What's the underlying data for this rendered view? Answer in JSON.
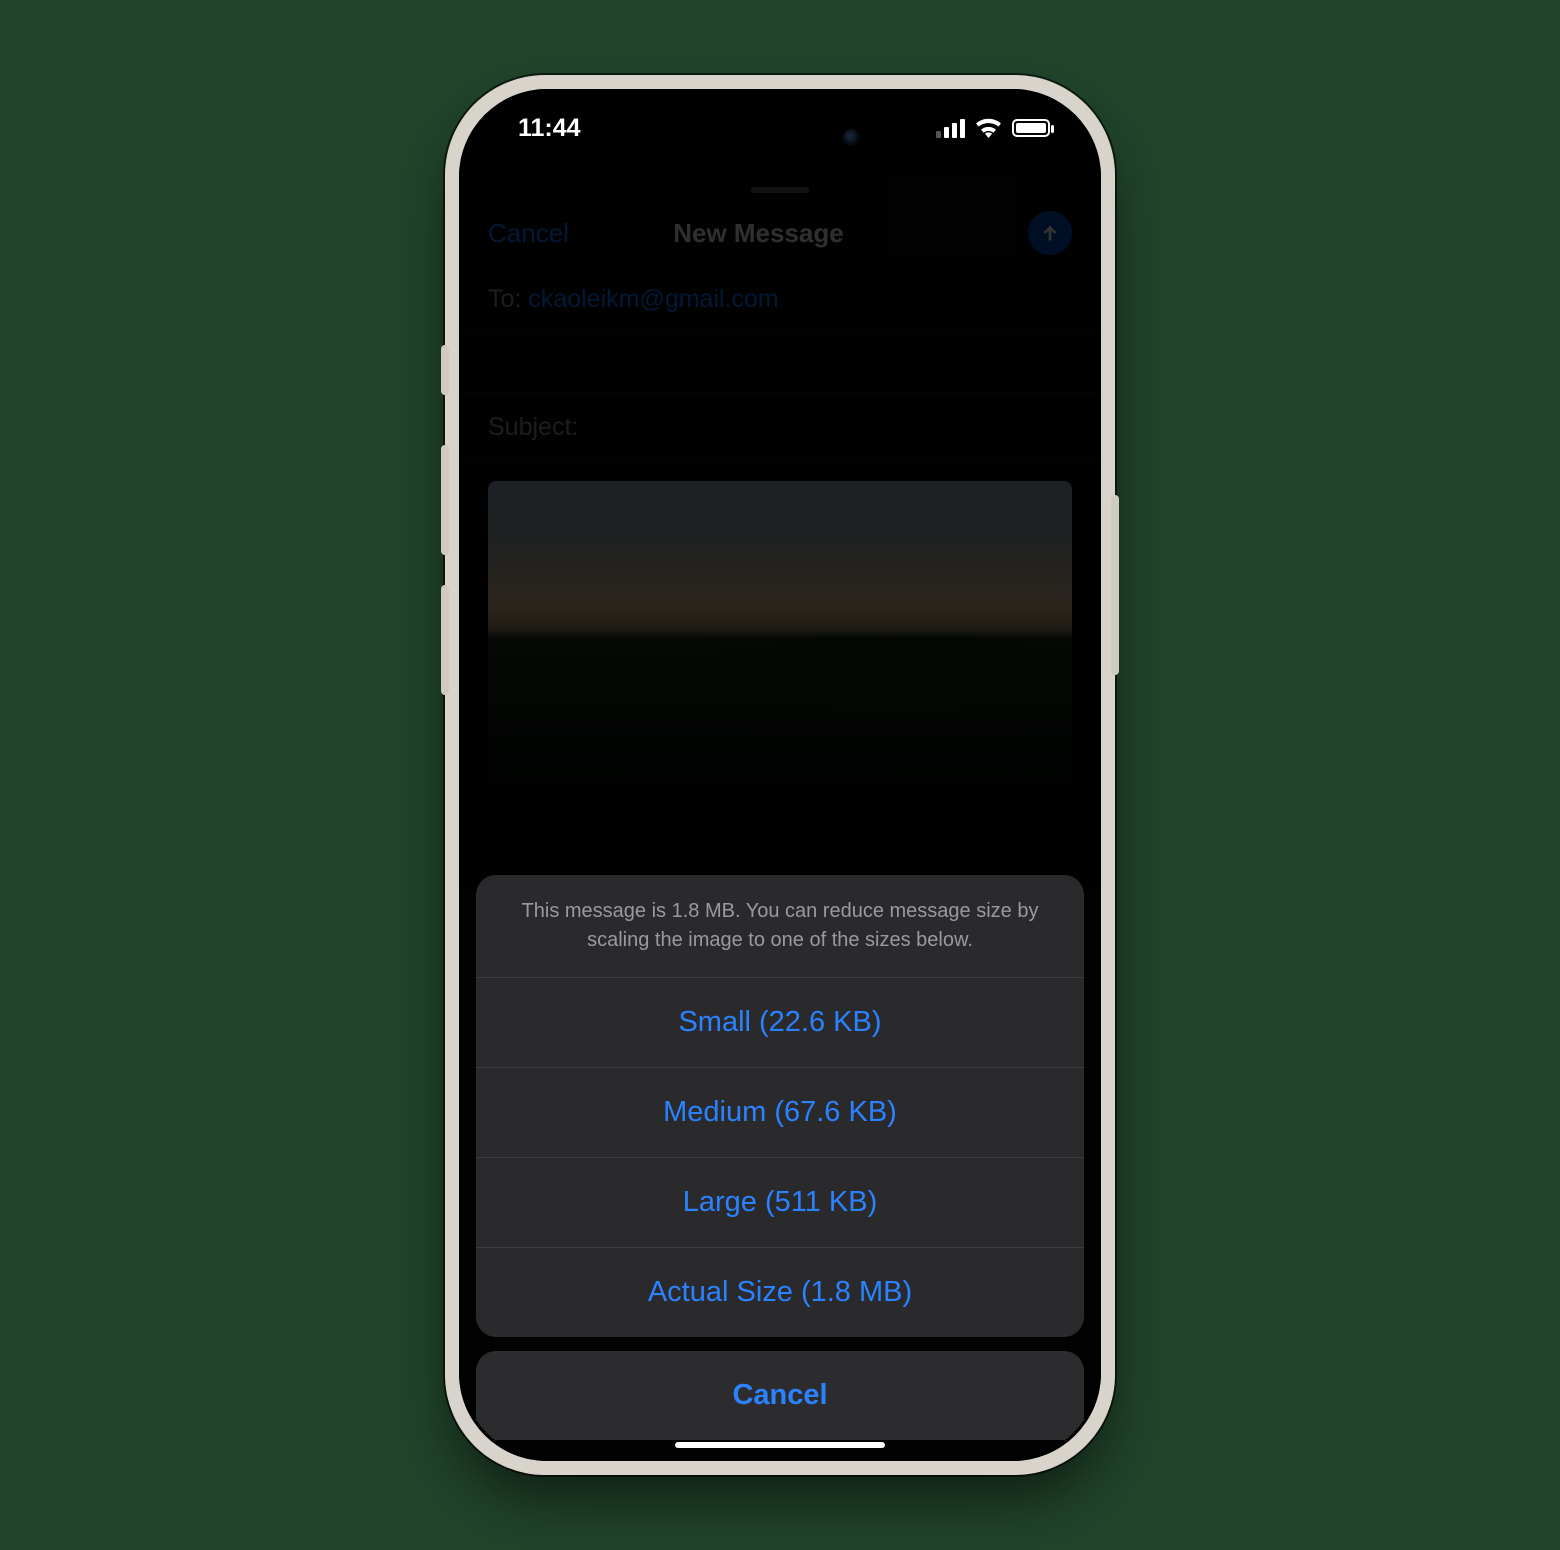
{
  "status": {
    "time": "11:44"
  },
  "compose": {
    "cancel": "Cancel",
    "title": "New Message",
    "to_label": "To: ",
    "to_value": "ckaoleikm@gmail.com",
    "subject_label": "Subject:"
  },
  "action_sheet": {
    "info": "This message is 1.8 MB. You can reduce message size by scaling the image to one of the sizes below.",
    "options": [
      "Small (22.6 KB)",
      "Medium (67.6 KB)",
      "Large (511 KB)",
      "Actual Size (1.8 MB)"
    ],
    "cancel": "Cancel"
  }
}
